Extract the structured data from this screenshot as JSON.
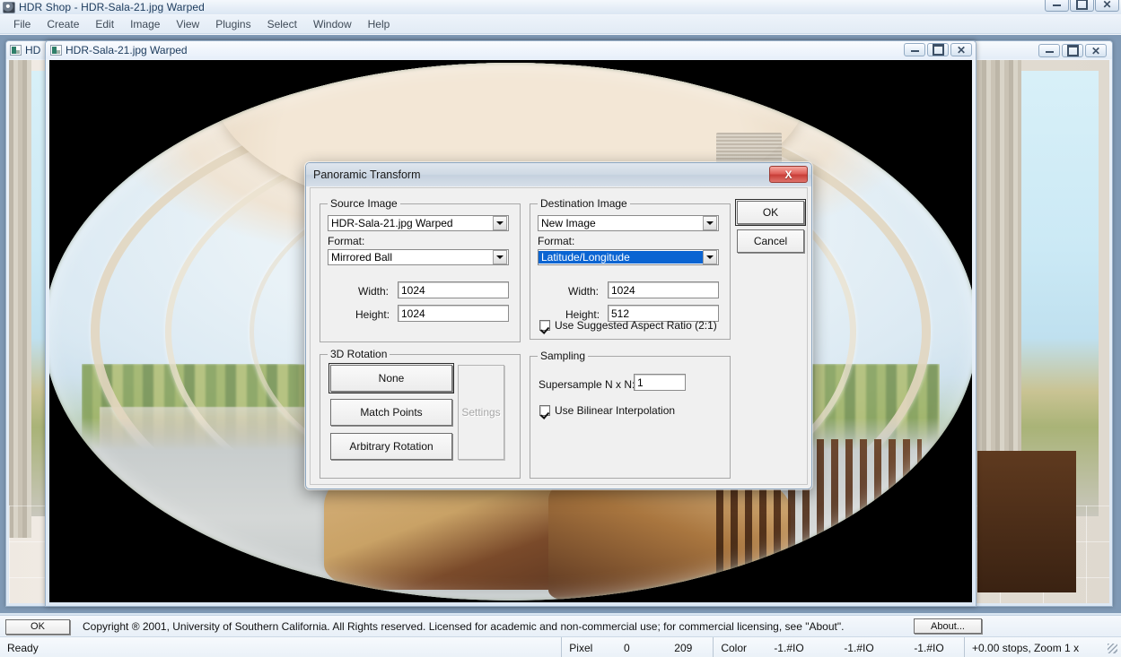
{
  "app": {
    "title": "HDR Shop - HDR-Sala-21.jpg Warped",
    "icon": "hdrshop-app-icon"
  },
  "window_controls": {
    "minimize": "minimize-icon",
    "maximize": "maximize-icon",
    "close": "close-icon"
  },
  "menu": {
    "items": [
      {
        "label": "File"
      },
      {
        "label": "Create"
      },
      {
        "label": "Edit"
      },
      {
        "label": "Image"
      },
      {
        "label": "View"
      },
      {
        "label": "Plugins"
      },
      {
        "label": "Select"
      },
      {
        "label": "Window"
      },
      {
        "label": "Help"
      }
    ]
  },
  "child_windows": {
    "back": {
      "title": "HD"
    },
    "front": {
      "title": "HDR-Sala-21.jpg Warped"
    }
  },
  "dialog": {
    "title": "Panoramic Transform",
    "close_label": "X",
    "source": {
      "legend": "Source Image",
      "image_value": "HDR-Sala-21.jpg Warped",
      "format_label": "Format:",
      "format_value": "Mirrored Ball",
      "width_label": "Width:",
      "width_value": "1024",
      "height_label": "Height:",
      "height_value": "1024"
    },
    "destination": {
      "legend": "Destination Image",
      "image_value": "New Image",
      "format_label": "Format:",
      "format_value": "Latitude/Longitude",
      "width_label": "Width:",
      "width_value": "1024",
      "height_label": "Height:",
      "height_value": "512",
      "aspect_ratio_label": "Use Suggested Aspect Ratio (2:1)",
      "aspect_ratio_checked": true
    },
    "rotation": {
      "legend": "3D Rotation",
      "none_label": "None",
      "match_points_label": "Match Points",
      "arbitrary_label": "Arbitrary Rotation",
      "settings_label": "Settings",
      "settings_disabled": true
    },
    "sampling": {
      "legend": "Sampling",
      "supersample_label": "Supersample N x N:",
      "supersample_value": "1",
      "bilinear_label": "Use Bilinear Interpolation",
      "bilinear_checked": true
    },
    "ok_label": "OK",
    "cancel_label": "Cancel"
  },
  "copyright_bar": {
    "ok_label": "OK",
    "text": "Copyright ® 2001, University of Southern California.  All Rights reserved.  Licensed for academic and non-commercial use; for commercial licensing, see \"About\".",
    "about_label": "About..."
  },
  "status_bar": {
    "ready": "Ready",
    "pixel_label": "Pixel",
    "pixel_x": "0",
    "pixel_y": "209",
    "color_label": "Color",
    "color_r": "-1.#IO",
    "color_g": "-1.#IO",
    "color_b": "-1.#IO",
    "zoom": "+0.00 stops, Zoom 1 x"
  },
  "colors": {
    "accent": "#0a64d2",
    "close_button": "#c83e38",
    "dialog_face": "#f0f0f0",
    "mdi_background": "#7f99b5"
  }
}
